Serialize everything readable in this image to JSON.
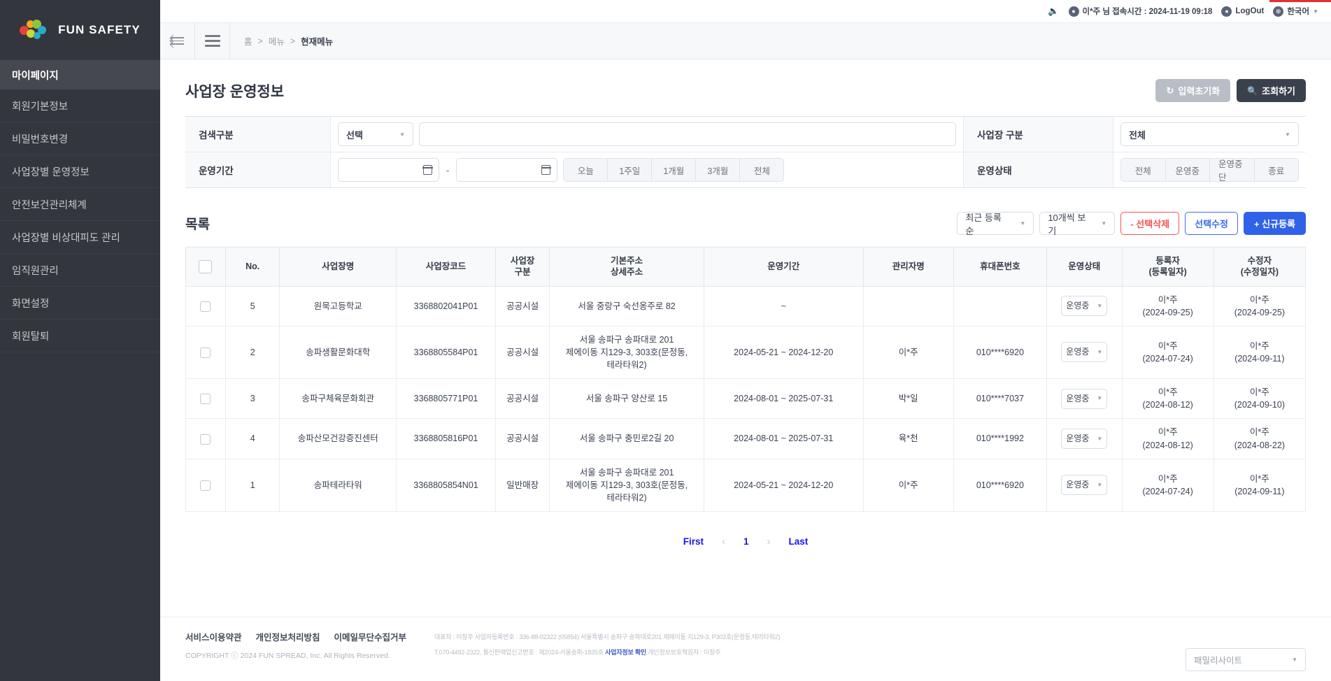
{
  "brand": {
    "name": "FUN SAFETY"
  },
  "sidebar": {
    "active_section": "마이페이지",
    "items": [
      {
        "label": "회원기본정보"
      },
      {
        "label": "비밀번호변경"
      },
      {
        "label": "사업장별 운영정보"
      },
      {
        "label": "안전보건관리체계"
      },
      {
        "label": "사업장별 비상대피도 관리"
      },
      {
        "label": "임직원관리"
      },
      {
        "label": "화면설정"
      },
      {
        "label": "회원탈퇴"
      }
    ]
  },
  "topbar": {
    "user_info": "이*주 님 접속시간 : 2024-11-19 09:18",
    "logout": "LogOut",
    "language": "한국어"
  },
  "breadcrumb": {
    "home": "홈",
    "sep1": ">",
    "menu": "메뉴",
    "sep2": ">",
    "current": "현재메뉴"
  },
  "page": {
    "title": "사업장 운영정보",
    "reset_label": "입력초기화",
    "search_label": "조회하기"
  },
  "filters": {
    "search_type_label": "검색구분",
    "search_type_value": "선택",
    "keyword_value": "",
    "keyword_placeholder": "",
    "site_type_label": "사업장 구분",
    "site_type_value": "전체",
    "period_label": "운영기간",
    "date_from": "",
    "date_to": "",
    "date_sep": "-",
    "quick_periods": [
      "오늘",
      "1주일",
      "1개월",
      "3개월",
      "전체"
    ],
    "status_label": "운영상태",
    "status_options": [
      "전체",
      "운영중",
      "운영중단",
      "종료"
    ]
  },
  "list": {
    "title": "목록",
    "sort_value": "최근 등록 순",
    "pagesize_value": "10개씩 보기",
    "delete_label": "- 선택삭제",
    "edit_label": "선택수정",
    "new_label": "+ 신규등록",
    "columns": [
      "No.",
      "사업장명",
      "사업장코드",
      "사업장\n구분",
      "기본주소\n상세주소",
      "운영기간",
      "관리자명",
      "휴대폰번호",
      "운영상태",
      "등록자\n(등록일자)",
      "수정자\n(수정일자)"
    ],
    "rows": [
      {
        "no": "5",
        "name": "원묵고등학교",
        "code": "3368802041P01",
        "type": "공공시설",
        "address": "서울 중랑구 숙선옹주로 82",
        "period": "~",
        "manager": "",
        "phone": "",
        "status": "운영중",
        "registrant": "이*주\n(2024-09-25)",
        "modifier": "이*주\n(2024-09-25)"
      },
      {
        "no": "2",
        "name": "송파생활문화대학",
        "code": "3368805584P01",
        "type": "공공시설",
        "address": "서울 송파구 송파대로 201\n제에이동 지129-3, 303호(문정동,\n테라타워2)",
        "period": "2024-05-21 ~ 2024-12-20",
        "manager": "이*주",
        "phone": "010****6920",
        "status": "운영중",
        "registrant": "이*주\n(2024-07-24)",
        "modifier": "이*주\n(2024-09-11)"
      },
      {
        "no": "3",
        "name": "송파구체육문화회관",
        "code": "3368805771P01",
        "type": "공공시설",
        "address": "서울 송파구 양산로 15",
        "period": "2024-08-01 ~ 2025-07-31",
        "manager": "박*일",
        "phone": "010****7037",
        "status": "운영중",
        "registrant": "이*주\n(2024-08-12)",
        "modifier": "이*주\n(2024-09-10)"
      },
      {
        "no": "4",
        "name": "송파산모건강증진센터",
        "code": "3368805816P01",
        "type": "공공시설",
        "address": "서울 송파구 충민로2길 20",
        "period": "2024-08-01 ~ 2025-07-31",
        "manager": "육*천",
        "phone": "010****1992",
        "status": "운영중",
        "registrant": "이*주\n(2024-08-12)",
        "modifier": "이*주\n(2024-08-22)"
      },
      {
        "no": "1",
        "name": "송파테라타워",
        "code": "3368805854N01",
        "type": "일반매장",
        "address": "서울 송파구 송파대로 201\n제에이동 지129-3, 303호(문정동,\n테라타워2)",
        "period": "2024-05-21 ~ 2024-12-20",
        "manager": "이*주",
        "phone": "010****6920",
        "status": "운영중",
        "registrant": "이*주\n(2024-07-24)",
        "modifier": "이*주\n(2024-09-11)"
      }
    ]
  },
  "pagination": {
    "first": "First",
    "prev": "‹",
    "page": "1",
    "next": "›",
    "last": "Last"
  },
  "footer": {
    "links": [
      "서비스이용약관",
      "개인정보처리방침",
      "이메일무단수집거부"
    ],
    "copyright": "COPYRIGHT ⓒ 2024 FUN SPREAD, Inc. All Rights Reserved.",
    "meta_line1": "대표자 : 이창주 사업자등록번호 : 336-88-02322 (05854) 서울특별시 송파구 송파대로201 제에이동 지129-3, P303호(문정동,테라타워2)",
    "meta_line2_a": "T.070-4492-2322, 통신판매업신고번호 : 제2024-서울송파-1835호 ",
    "meta_line2_link": "사업자정보 확인",
    "meta_line2_b": " 개인정보보호책임자 : 이창주",
    "familysite": "패밀리사이트"
  }
}
